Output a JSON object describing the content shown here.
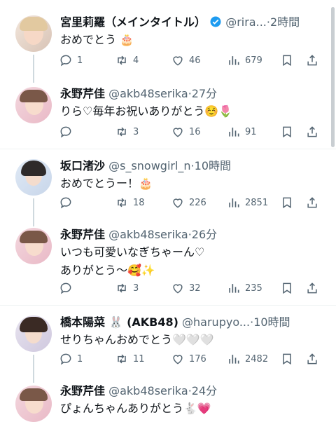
{
  "tweets": [
    {
      "name": "宮里莉羅（メインタイトル）",
      "handle": "@rira...",
      "time": "2時間",
      "verified": true,
      "lines": [
        "おめでとう 🎂"
      ],
      "reply": "1",
      "retweet": "4",
      "like": "46",
      "views": "679"
    },
    {
      "name": "永野芹佳",
      "handle": "@akb48serika",
      "time": "27分",
      "lines": [
        "りら♡毎年お祝いありがとう☺️🌷"
      ],
      "reply": "",
      "retweet": "3",
      "like": "16",
      "views": "91"
    },
    {
      "name": "坂口渚沙",
      "handle": "@s_snowgirl_n",
      "time": "10時間",
      "lines": [
        "おめでとうー！🎂"
      ],
      "reply": "",
      "retweet": "18",
      "like": "226",
      "views": "2851"
    },
    {
      "name": "永野芹佳",
      "handle": "@akb48serika",
      "time": "26分",
      "lines": [
        "いつも可愛いなぎちゃーん♡",
        "ありがとう〜🥰✨"
      ],
      "reply": "",
      "retweet": "3",
      "like": "32",
      "views": "235"
    },
    {
      "name": "橋本陽菜 🐰 (AKB48)",
      "handle": "@harupyo...",
      "time": "10時間",
      "lines": [
        "せりちゃんおめでとう🤍🤍🤍"
      ],
      "reply": "1",
      "retweet": "11",
      "like": "176",
      "views": "2482"
    },
    {
      "name": "永野芹佳",
      "handle": "@akb48serika",
      "time": "24分",
      "lines": [
        "ぴょんちゃんありがとう🐇💗"
      ],
      "reply": "",
      "retweet": "",
      "like": "",
      "views": ""
    }
  ],
  "colors": {
    "text": "#0f1419",
    "secondary": "#536471",
    "verified": "#1d9bf0",
    "divider": "#eff3f4"
  }
}
